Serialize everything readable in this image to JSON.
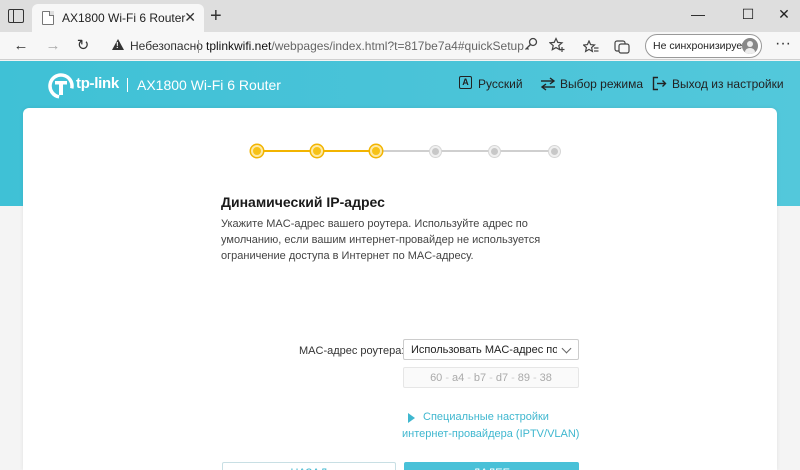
{
  "browser": {
    "tab_title": "AX1800 Wi-Fi 6 Router",
    "tab_close": "✕",
    "new_tab": "+",
    "window_controls": {
      "minimize": "—",
      "maximize": "☐",
      "close": "✕"
    },
    "nav": {
      "back": "←",
      "forward": "→",
      "reload": "↻"
    },
    "address": {
      "security_label": "Небезопасно",
      "host": "tplinkwifi.net",
      "path": "/webpages/index.html?t=817be7a4#quickSetup"
    },
    "sync_label": "Не синхронизируется",
    "more": "···",
    "icons": [
      "tab-actions-icon",
      "warning-icon",
      "key-icon",
      "favorite-add-icon",
      "favorites-icon",
      "collections-icon",
      "avatar-icon"
    ]
  },
  "header": {
    "brand": "tp-link",
    "separator": "|",
    "model": "AX1800 Wi-Fi 6 Router",
    "language": {
      "icon": "A",
      "label": "Русский"
    },
    "mode": {
      "label": "Выбор режима"
    },
    "logout": {
      "label": "Выход из настройки"
    }
  },
  "stepper": {
    "total": 6,
    "completed": 3,
    "colors": {
      "done": "#f7c217",
      "line_done": "#f2b400",
      "todo": "#c8c8c8",
      "line_todo": "#cfcfcf"
    }
  },
  "form": {
    "title": "Динамический IP-адрес",
    "description": "Укажите MAC-адрес вашего роутера. Используйте адрес по умолчанию, если вашим интернет-провайдер не используется ограничение доступа в Интернет по MAC-адресу.",
    "mac_label": "MAC-адрес роутера:",
    "mac_select_value": "Использовать MAC-адрес по умолчанию",
    "mac_parts": [
      "60",
      "a4",
      "b7",
      "d7",
      "89",
      "38"
    ],
    "mac_separator": "-",
    "isp_link_line1": "Специальные настройки",
    "isp_link_line2": "интернет-провайдера (IPTV/VLAN)",
    "back_label": "НАЗАД",
    "next_label": "ДАЛЕЕ"
  },
  "colors": {
    "accent": "#49c1d8",
    "link": "#3fb7cf",
    "hero": "#48c2d7"
  }
}
